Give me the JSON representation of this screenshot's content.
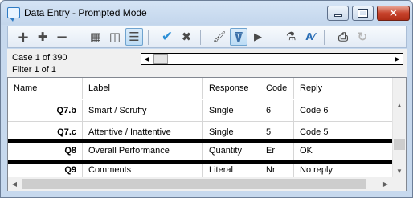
{
  "window": {
    "title": "Data Entry - Prompted Mode",
    "close_glyph": "✕"
  },
  "toolbar": {
    "buttons": [
      {
        "name": "add-icon",
        "glyph": "+",
        "color": "#4a4a4a"
      },
      {
        "name": "insert-icon",
        "glyph": "✚",
        "color": "#4a4a4a"
      },
      {
        "name": "remove-icon",
        "glyph": "−",
        "color": "#4a4a4a"
      },
      {
        "name": "grid-view-icon",
        "glyph": "▦",
        "color": "#5a5a5a"
      },
      {
        "name": "split-view-icon",
        "glyph": "◫",
        "color": "#5a5a5a"
      },
      {
        "name": "list-view-icon",
        "glyph": "☰",
        "color": "#5a5a5a"
      },
      {
        "name": "accept-icon",
        "glyph": "✔",
        "color": "#2c8fd6"
      },
      {
        "name": "cancel-icon",
        "glyph": "✖",
        "color": "#505050"
      },
      {
        "name": "brush-icon",
        "glyph": "🖌",
        "color": "#505050"
      },
      {
        "name": "filter-icon",
        "glyph": "⊽",
        "color": "#3a6fa8"
      },
      {
        "name": "run-icon",
        "glyph": "▶",
        "color": "#505050"
      },
      {
        "name": "flask-icon",
        "glyph": "⚗",
        "color": "#505050"
      },
      {
        "name": "spellcheck-icon",
        "glyph": "A⁄",
        "color": "#2c6fb6"
      },
      {
        "name": "print-icon",
        "glyph": "⎙",
        "color": "#404040"
      },
      {
        "name": "refresh-icon",
        "glyph": "↻",
        "color": "#b5b5b5"
      }
    ]
  },
  "status": {
    "case": "Case 1 of 390",
    "filter": "Filter 1 of 1"
  },
  "grid": {
    "columns": [
      "Name",
      "Label",
      "Response",
      "Code",
      "Reply"
    ],
    "rows": [
      {
        "name": "Q7.b",
        "label": "Smart / Scruffy",
        "response": "Single",
        "code": "6",
        "reply": "Code 6"
      },
      {
        "name": "Q7.c",
        "label": "Attentive / Inattentive",
        "response": "Single",
        "code": "5",
        "reply": "Code 5"
      },
      {
        "name": "Q8",
        "label": "Overall Performance",
        "response": "Quantity",
        "code": "Er",
        "reply": "OK"
      },
      {
        "name": "Q9",
        "label": "Comments",
        "response": "Literal",
        "code": "Nr",
        "reply": "No reply"
      }
    ],
    "selected_row": 2
  }
}
